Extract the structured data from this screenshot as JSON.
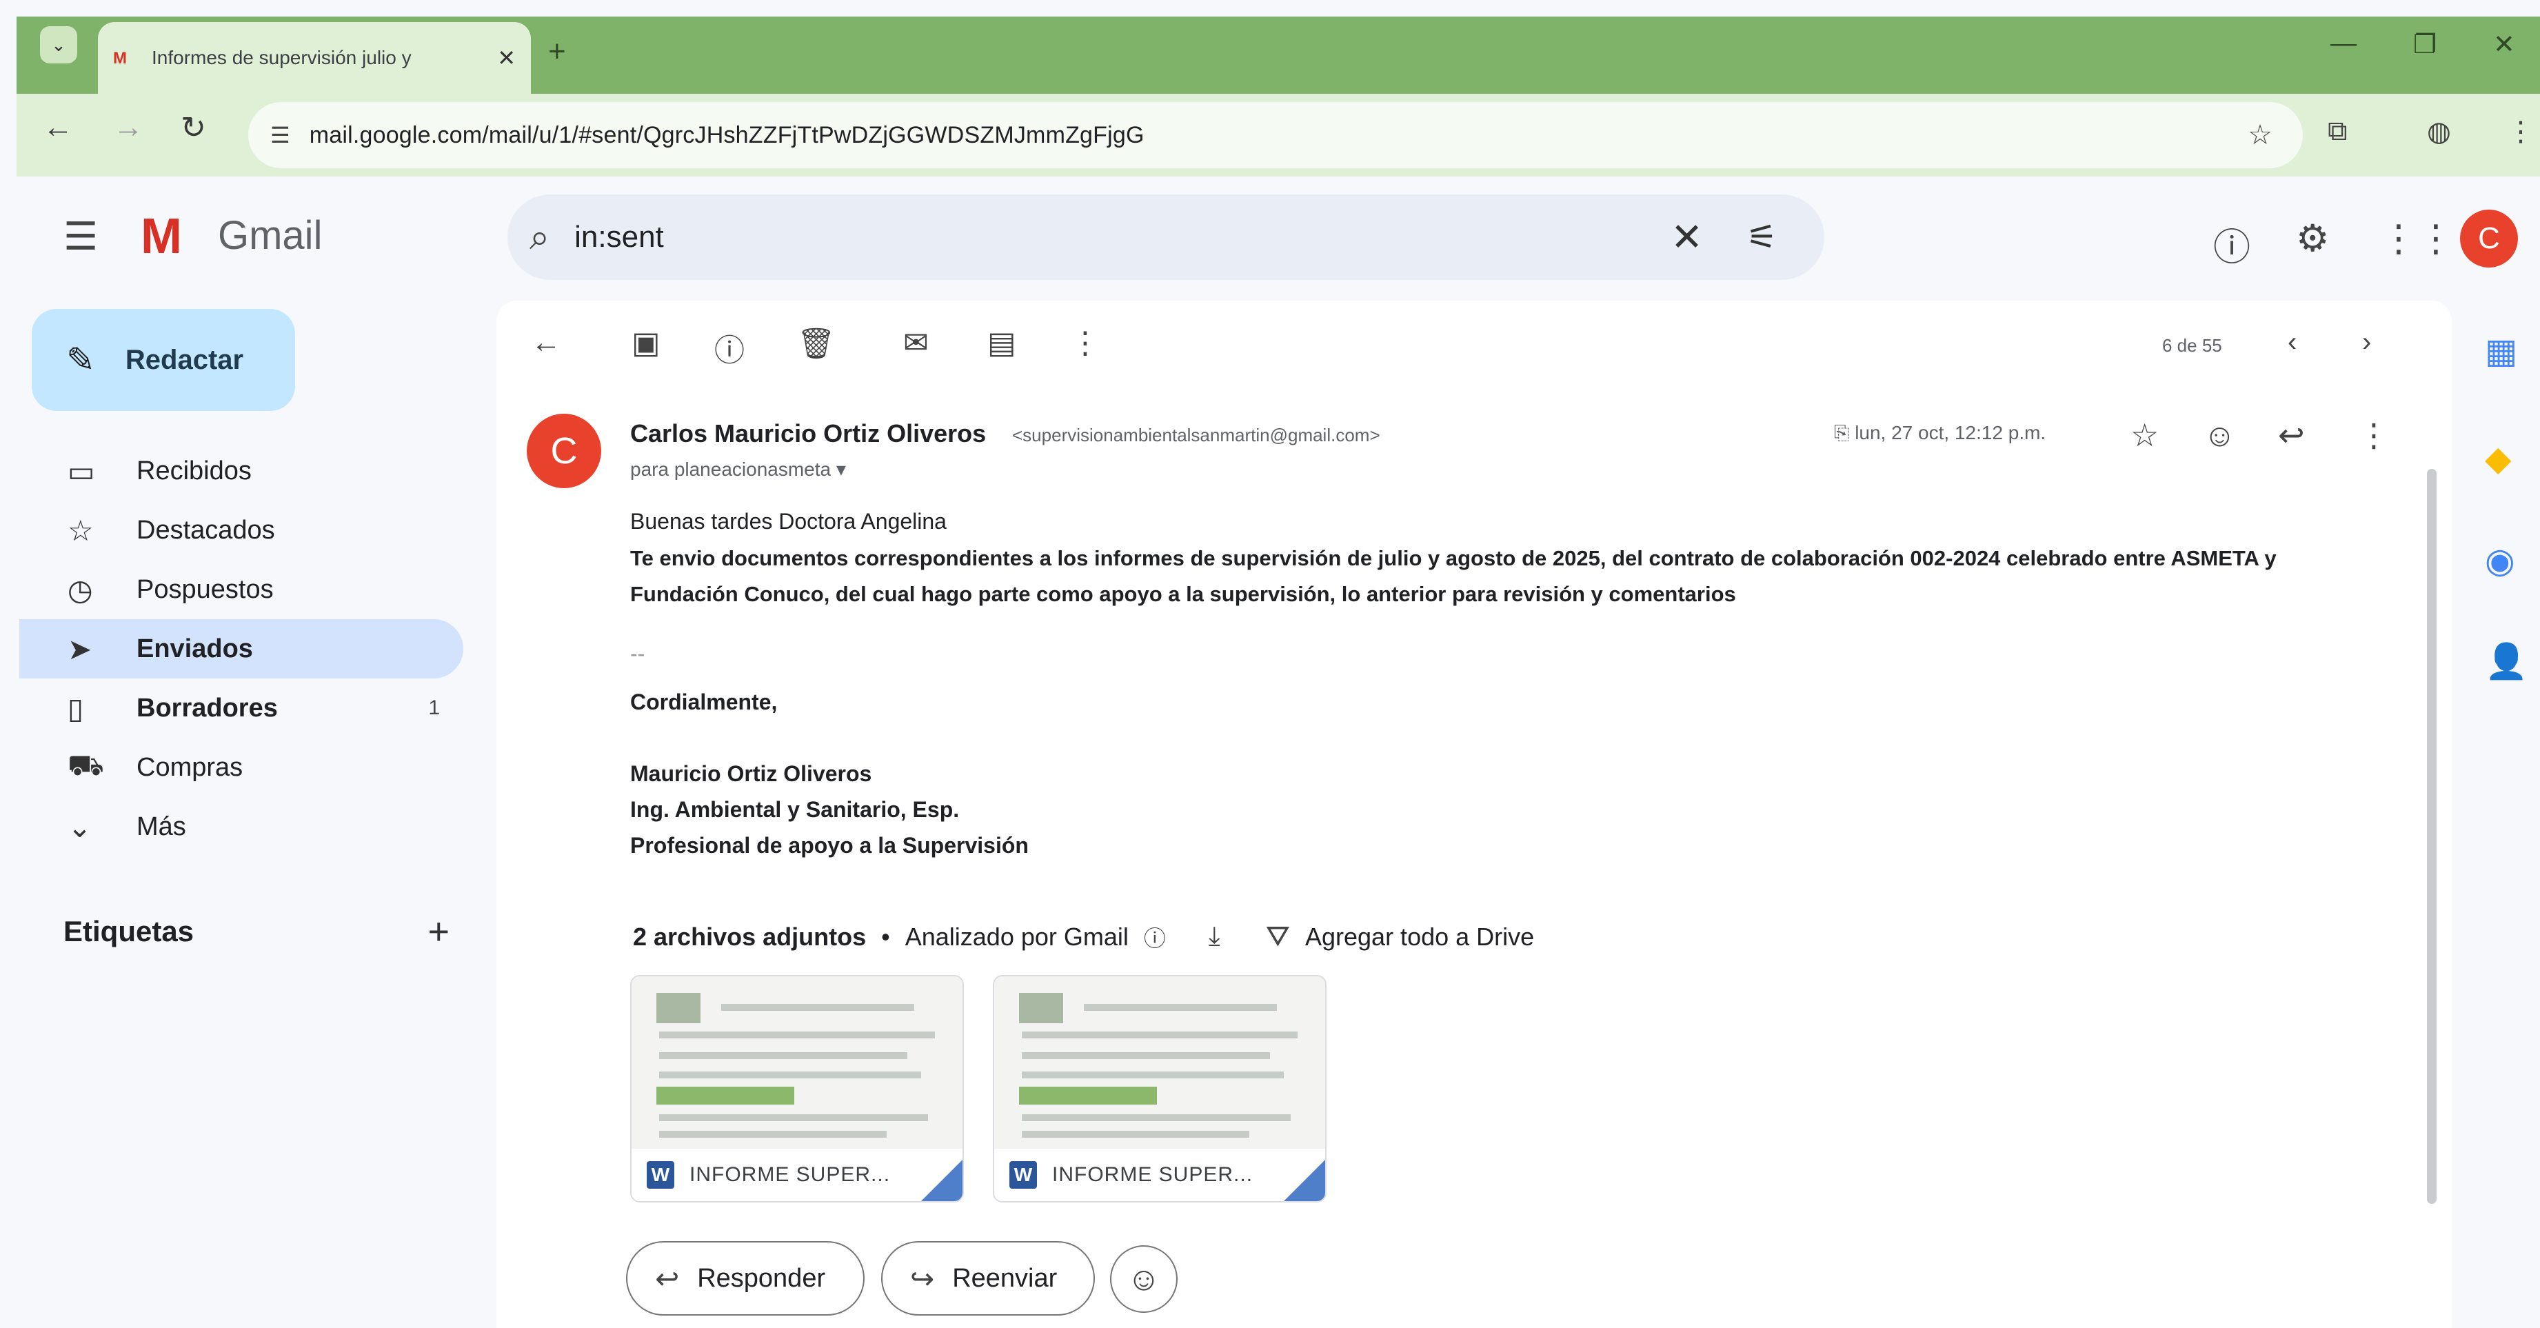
{
  "browser": {
    "tab_title": "Informes de supervisión julio y",
    "tab_favicon": "M",
    "url": "mail.google.com/mail/u/1/#sent/QgrcJHshZZFjTtPwDZjGGWDSZMJmmZgFjgG",
    "colors": {
      "frame": "#7fb36a",
      "toolbar": "#dff0d6"
    }
  },
  "header": {
    "app_name": "Gmail",
    "search_query": "in:sent"
  },
  "sidebar": {
    "compose_label": "Redactar",
    "items": [
      {
        "label": "Recibidos",
        "icon": "inbox-icon",
        "glyph": "▭"
      },
      {
        "label": "Destacados",
        "icon": "star-icon",
        "glyph": "☆"
      },
      {
        "label": "Pospuestos",
        "icon": "clock-icon",
        "glyph": "◷"
      },
      {
        "label": "Enviados",
        "icon": "send-icon",
        "glyph": "➤",
        "active": true
      },
      {
        "label": "Borradores",
        "icon": "draft-icon",
        "glyph": "▯",
        "count": "1"
      },
      {
        "label": "Compras",
        "icon": "shopping-icon",
        "glyph": "⛟"
      },
      {
        "label": "Más",
        "icon": "chevron-down-icon",
        "glyph": "⌄"
      }
    ],
    "labels_title": "Etiquetas"
  },
  "toolbar": {
    "pager": "6 de 55"
  },
  "message": {
    "avatar_letter": "C",
    "sender_name": "Carlos Mauricio Ortiz Oliveros",
    "sender_email": "<supervisionambientalsanmartin@gmail.com>",
    "to": "para planeacionasmeta",
    "date": "lun, 27 oct, 12:12 p.m.",
    "greeting": "Buenas tardes Doctora Angelina",
    "body_line1": "Te envio documentos correspondientes a los informes de supervisión de julio y agosto de 2025, del contrato de colaboración 002-2024 celebrado entre ASMETA y",
    "body_line2": "Fundación Conuco, del cual hago parte como apoyo a la supervisión, lo anterior para revisión y comentarios",
    "closing": "Cordialmente,",
    "sig_name": "Mauricio Ortiz Oliveros",
    "sig_title": "Ing. Ambiental y Sanitario, Esp.",
    "sig_role": "Profesional de apoyo a la Supervisión"
  },
  "attachments": {
    "count_label": "2 archivos adjuntos",
    "scanned_label": "Analizado por Gmail",
    "drive_label": "Agregar todo a Drive",
    "files": [
      {
        "name": "INFORME SUPER...",
        "type": "W"
      },
      {
        "name": "INFORME SUPER...",
        "type": "W"
      }
    ]
  },
  "actions": {
    "reply_label": "Responder",
    "forward_label": "Reenviar"
  }
}
